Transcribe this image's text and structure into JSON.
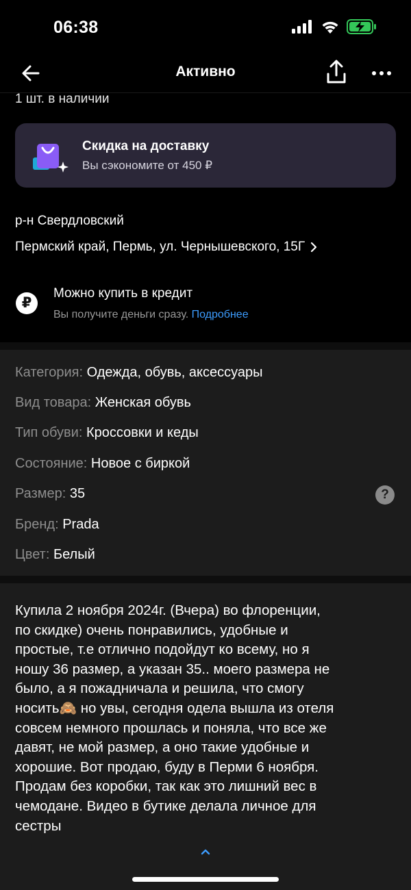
{
  "status_bar": {
    "time": "06:38",
    "icons": [
      "signal-icon",
      "wifi-icon",
      "battery-charging-icon"
    ],
    "battery_color": "#34c759"
  },
  "nav": {
    "title": "Активно",
    "icons": [
      "back-arrow-icon",
      "share-icon",
      "more-icon"
    ]
  },
  "listing": {
    "stock": "1 шт. в наличии",
    "promo": {
      "title": "Скидка на доставку",
      "subtitle": "Вы сэкономите от 450 ₽",
      "icon": "shopping-bag-icon"
    },
    "location": {
      "district": "р-н Свердловский",
      "address": "Пермский край, Пермь, ул. Чернышевского, 15Г",
      "chevron": "›"
    },
    "credit": {
      "icon_glyph": "₽",
      "title": "Можно купить в кредит",
      "subtitle": "Вы получите деньги сразу.",
      "link": "Подробнее"
    }
  },
  "attributes": [
    {
      "key": "Категория:",
      "value": "Одежда, обувь, аксессуары"
    },
    {
      "key": "Вид товара:",
      "value": "Женская обувь"
    },
    {
      "key": "Тип обуви:",
      "value": "Кроссовки и кеды"
    },
    {
      "key": "Состояние:",
      "value": "Новое с биркой"
    },
    {
      "key": "Размер:",
      "value": "35"
    },
    {
      "key": "Бренд:",
      "value": "Prada"
    },
    {
      "key": "Цвет:",
      "value": "Белый"
    }
  ],
  "size_help_glyph": "?",
  "description": {
    "lines": [
      "Купила 2 ноября 2024г. (Вчера) во флоренции,",
      "по скидке) очень понравились, удобные и",
      "простые, т.е отлично подойдут ко всему, но я",
      "ношу 36 размер, а указан 35.. моего размера не",
      "было, а я пожадничала и решила, что смогу",
      "носить🙈 но увы, сегодня одела вышла из отеля",
      "совсем немного прошлась и поняла, что все же",
      "давят, не мой размер, а оно такие удобные и",
      "хорошие. Вот продаю, буду в Перми 6 ноября.",
      "Продам без коробки, так как это лишний вес в",
      "чемодане. Видео в бутике делала личное для",
      "сестры"
    ]
  },
  "colors": {
    "background": "#000000",
    "card": "#1c1c1c",
    "promo_bg": "#2b2738",
    "link": "#3d9dff",
    "muted": "#8e8e8e"
  }
}
